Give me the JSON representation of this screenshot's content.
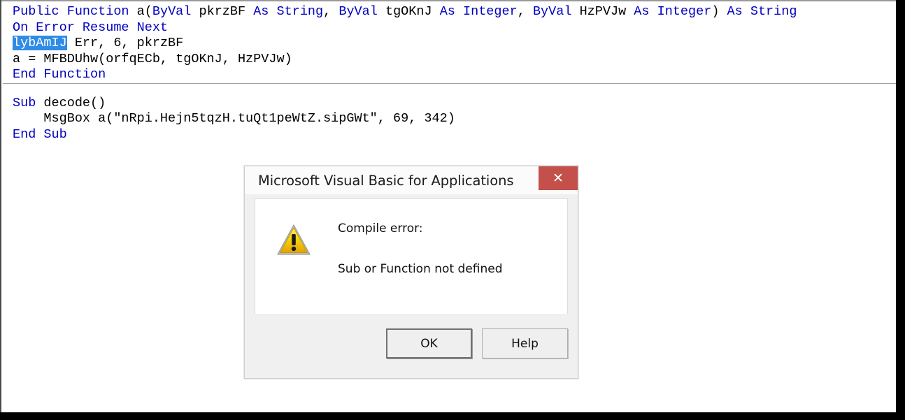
{
  "editor": {
    "procedures": [
      {
        "name": "encode-helper-function",
        "lines": [
          [
            {
              "t": "Public Function ",
              "c": "kw"
            },
            {
              "t": "a(",
              "c": "id"
            },
            {
              "t": "ByVal ",
              "c": "kw"
            },
            {
              "t": "pkrzBF ",
              "c": "id"
            },
            {
              "t": "As String",
              "c": "kw"
            },
            {
              "t": ", ",
              "c": "id"
            },
            {
              "t": "ByVal ",
              "c": "kw"
            },
            {
              "t": "tgOKnJ ",
              "c": "id"
            },
            {
              "t": "As Integer",
              "c": "kw"
            },
            {
              "t": ", ",
              "c": "id"
            },
            {
              "t": "ByVal ",
              "c": "kw"
            },
            {
              "t": "HzPVJw ",
              "c": "id"
            },
            {
              "t": "As Integer",
              "c": "kw"
            },
            {
              "t": ") ",
              "c": "id"
            },
            {
              "t": "As String",
              "c": "kw"
            }
          ],
          [
            {
              "t": "On Error Resume Next",
              "c": "kw"
            }
          ],
          [
            {
              "t": "lybAmIJ",
              "c": "sel"
            },
            {
              "t": " Err, 6, pkrzBF",
              "c": "id"
            }
          ],
          [
            {
              "t": "a = MFBDUhw(orfqECb, tgOKnJ, HzPVJw)",
              "c": "id"
            }
          ],
          [
            {
              "t": "End Function",
              "c": "kw"
            }
          ]
        ]
      },
      {
        "name": "decode-sub",
        "lines": [
          [
            {
              "t": "Sub ",
              "c": "kw"
            },
            {
              "t": "decode()",
              "c": "id"
            }
          ],
          [
            {
              "t": "    MsgBox a(\"nRpi.Hejn5tqzH.tuQt1peWtZ.sipGWt\", 69, 342)",
              "c": "id"
            }
          ],
          [
            {
              "t": "End Sub",
              "c": "kw"
            }
          ]
        ]
      }
    ],
    "selection_text": "lybAmIJ",
    "colors": {
      "keyword": "#0000c0",
      "identifier": "#000000",
      "selection_background": "#2e8be6",
      "selection_foreground": "#ffffff",
      "editor_background": "#ffffff"
    }
  },
  "dialog": {
    "title": "Microsoft Visual Basic for Applications",
    "close_glyph": "✕",
    "icon_name": "warning-triangle-icon",
    "message_line_1": "Compile error:",
    "message_line_2": "Sub or Function not defined",
    "buttons": [
      {
        "label": "OK",
        "name": "ok-button",
        "default": true
      },
      {
        "label": "Help",
        "name": "help-button",
        "default": false
      }
    ],
    "colors": {
      "close_button": "#c4504c",
      "titlebar": "#fbfbfb",
      "footer": "#f0f0f0",
      "body": "#ffffff",
      "warning_fill": "#ffd200",
      "warning_fill_dark": "#e8a900"
    }
  }
}
